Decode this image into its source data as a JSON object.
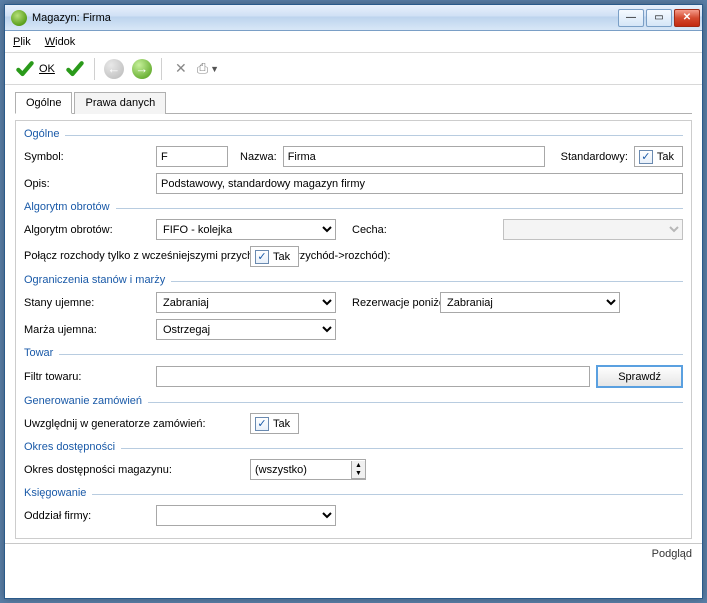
{
  "title": "Magazyn: Firma",
  "menu": {
    "plik": "Plik",
    "widok": "Widok"
  },
  "toolbar": {
    "ok": "OK"
  },
  "tabs": {
    "general": "Ogólne",
    "rights": "Prawa danych"
  },
  "g1": {
    "title": "Ogólne",
    "symbol_lbl": "Symbol:",
    "symbol": "F",
    "name_lbl": "Nazwa:",
    "name": "Firma",
    "std_lbl": "Standardowy:",
    "std_cb": "Tak",
    "desc_lbl": "Opis:",
    "desc": "Podstawowy, standardowy magazyn firmy"
  },
  "g2": {
    "title": "Algorytm obrotów",
    "algo_lbl": "Algorytm obrotów:",
    "algo": "FIFO - kolejka",
    "feat_lbl": "Cecha:",
    "link_lbl": "Połącz rozchody tylko z wcześniejszymi przychodami (przychód->rozchód):",
    "link_cb": "Tak"
  },
  "g3": {
    "title": "Ograniczenia stanów i marży",
    "neg_lbl": "Stany ujemne:",
    "neg": "Zabraniaj",
    "res_lbl": "Rezerwacje poniżej stanu:",
    "res": "Zabraniaj",
    "margin_lbl": "Marża ujemna:",
    "margin": "Ostrzegaj"
  },
  "g4": {
    "title": "Towar",
    "filter_lbl": "Filtr towaru:",
    "check_btn": "Sprawdź"
  },
  "g5": {
    "title": "Generowanie zamówień",
    "gen_lbl": "Uwzględnij w generatorze zamówień:",
    "gen_cb": "Tak"
  },
  "g6": {
    "title": "Okres dostępności",
    "period_lbl": "Okres dostępności magazynu:",
    "period": "(wszystko)"
  },
  "g7": {
    "title": "Księgowanie",
    "branch_lbl": "Oddział firmy:"
  },
  "status": "Podgląd"
}
